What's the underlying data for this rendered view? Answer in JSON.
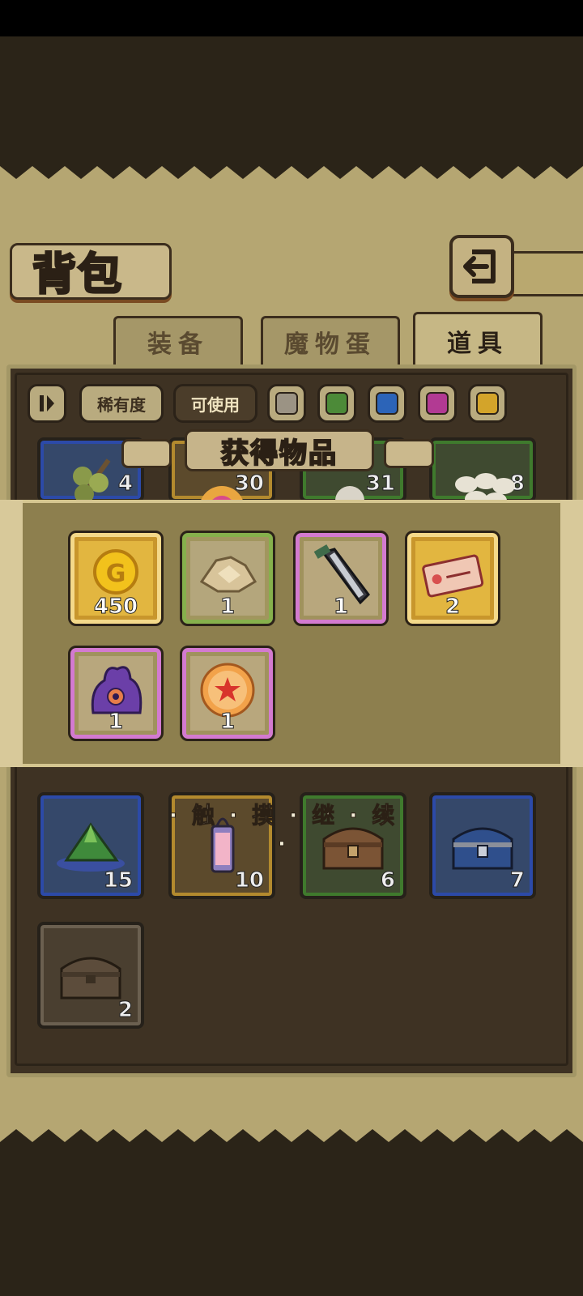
{
  "page": {
    "title": "背包",
    "back_icon": "back-arrow-icon"
  },
  "tabs": [
    {
      "label": "装备",
      "active": false
    },
    {
      "label": "魔物蛋",
      "active": false
    },
    {
      "label": "道具",
      "active": true
    }
  ],
  "filters": {
    "sort_icon": "sort-toggle-icon",
    "rarity_label": "稀有度",
    "usable_label": "可使用",
    "swatches": [
      "#9b9384",
      "#4c8a38",
      "#2c64b8",
      "#b23a93",
      "#d3a42a"
    ]
  },
  "inventory": {
    "top_row_counts": [
      "4",
      "30",
      "31",
      "8"
    ],
    "items": [
      {
        "name": "green-crystal",
        "count": "15",
        "rarity": "blue"
      },
      {
        "name": "lantern",
        "count": "10",
        "rarity": "gold"
      },
      {
        "name": "wooden-chest",
        "count": "6",
        "rarity": "green"
      },
      {
        "name": "blue-chest",
        "count": "7",
        "rarity": "blue"
      },
      {
        "name": "plain-chest",
        "count": "2",
        "rarity": "gray"
      }
    ]
  },
  "reward_popup": {
    "title": "获得物品",
    "continue_hint": "· 触 · 摸 · 继 · 续 ·",
    "items": [
      {
        "name": "gold-coin",
        "count": "450",
        "rarity": "gold"
      },
      {
        "name": "ore",
        "count": "1",
        "rarity": "green"
      },
      {
        "name": "sword",
        "count": "1",
        "rarity": "purple"
      },
      {
        "name": "ticket",
        "count": "2",
        "rarity": "gold"
      },
      {
        "name": "purple-monster",
        "count": "1",
        "rarity": "purple"
      },
      {
        "name": "star-orb",
        "count": "1",
        "rarity": "purple"
      }
    ]
  }
}
